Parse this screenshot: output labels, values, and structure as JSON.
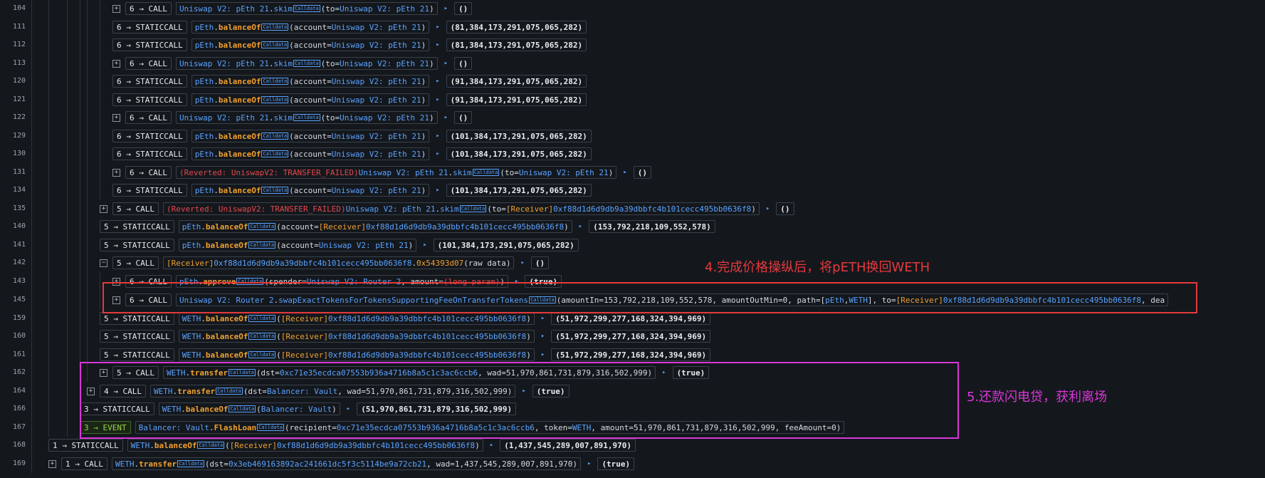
{
  "colors": {
    "address": "#5aa2ff",
    "tag": "#f0a030",
    "reverted": "#e5484d",
    "annotation_red": "#e5393b",
    "annotation_magenta": "#d936d9"
  },
  "icons": {
    "expand": "plus-square-icon",
    "collapse": "minus-square-icon",
    "return": "triangle-right-icon",
    "calldata": "calldata-icon"
  },
  "calldata_label": "Calldata",
  "annotations": {
    "step4": "4.完成价格操纵后，将pETH换回WETH",
    "step5": "5.还款闪电贷，获利离场"
  },
  "rows": [
    {
      "line": "104",
      "depth": "6",
      "type": "CALL",
      "toggle": "+",
      "segs": [
        [
          "Uniswap V2: pEth 21",
          "blue"
        ],
        [
          ".",
          ""
        ],
        [
          "skim",
          "blue"
        ],
        [
          "#cd",
          ""
        ],
        [
          "(to=",
          ""
        ],
        [
          "Uniswap V2: pEth 21",
          "blue"
        ],
        [
          ")",
          ""
        ]
      ],
      "ret": "()"
    },
    {
      "line": "111",
      "depth": "6",
      "type": "STATICCALL",
      "toggle": "",
      "segs": [
        [
          "pEth",
          "blue"
        ],
        [
          ".",
          ""
        ],
        [
          "balanceOf",
          "b"
        ],
        [
          "#cd",
          ""
        ],
        [
          "(account=",
          ""
        ],
        [
          "Uniswap V2: pEth 21",
          "blue"
        ],
        [
          ")",
          ""
        ]
      ],
      "ret": "(81,384,173,291,075,065,282)"
    },
    {
      "line": "112",
      "depth": "6",
      "type": "STATICCALL",
      "toggle": "",
      "segs": [
        [
          "pEth",
          "blue"
        ],
        [
          ".",
          ""
        ],
        [
          "balanceOf",
          "b"
        ],
        [
          "#cd",
          ""
        ],
        [
          "(account=",
          ""
        ],
        [
          "Uniswap V2: pEth 21",
          "blue"
        ],
        [
          ")",
          ""
        ]
      ],
      "ret": "(81,384,173,291,075,065,282)"
    },
    {
      "line": "113",
      "depth": "6",
      "type": "CALL",
      "toggle": "+",
      "segs": [
        [
          "Uniswap V2: pEth 21",
          "blue"
        ],
        [
          ".",
          ""
        ],
        [
          "skim",
          "blue"
        ],
        [
          "#cd",
          ""
        ],
        [
          "(to=",
          ""
        ],
        [
          "Uniswap V2: pEth 21",
          "blue"
        ],
        [
          ")",
          ""
        ]
      ],
      "ret": "()"
    },
    {
      "line": "120",
      "depth": "6",
      "type": "STATICCALL",
      "toggle": "",
      "segs": [
        [
          "pEth",
          "blue"
        ],
        [
          ".",
          ""
        ],
        [
          "balanceOf",
          "b"
        ],
        [
          "#cd",
          ""
        ],
        [
          "(account=",
          ""
        ],
        [
          "Uniswap V2: pEth 21",
          "blue"
        ],
        [
          ")",
          ""
        ]
      ],
      "ret": "(91,384,173,291,075,065,282)"
    },
    {
      "line": "121",
      "depth": "6",
      "type": "STATICCALL",
      "toggle": "",
      "segs": [
        [
          "pEth",
          "blue"
        ],
        [
          ".",
          ""
        ],
        [
          "balanceOf",
          "b"
        ],
        [
          "#cd",
          ""
        ],
        [
          "(account=",
          ""
        ],
        [
          "Uniswap V2: pEth 21",
          "blue"
        ],
        [
          ")",
          ""
        ]
      ],
      "ret": "(91,384,173,291,075,065,282)"
    },
    {
      "line": "122",
      "depth": "6",
      "type": "CALL",
      "toggle": "+",
      "segs": [
        [
          "Uniswap V2: pEth 21",
          "blue"
        ],
        [
          ".",
          ""
        ],
        [
          "skim",
          "blue"
        ],
        [
          "#cd",
          ""
        ],
        [
          "(to=",
          ""
        ],
        [
          "Uniswap V2: pEth 21",
          "blue"
        ],
        [
          ")",
          ""
        ]
      ],
      "ret": "()"
    },
    {
      "line": "129",
      "depth": "6",
      "type": "STATICCALL",
      "toggle": "",
      "segs": [
        [
          "pEth",
          "blue"
        ],
        [
          ".",
          ""
        ],
        [
          "balanceOf",
          "b"
        ],
        [
          "#cd",
          ""
        ],
        [
          "(account=",
          ""
        ],
        [
          "Uniswap V2: pEth 21",
          "blue"
        ],
        [
          ")",
          ""
        ]
      ],
      "ret": "(101,384,173,291,075,065,282)"
    },
    {
      "line": "130",
      "depth": "6",
      "type": "STATICCALL",
      "toggle": "",
      "segs": [
        [
          "pEth",
          "blue"
        ],
        [
          ".",
          ""
        ],
        [
          "balanceOf",
          "b"
        ],
        [
          "#cd",
          ""
        ],
        [
          "(account=",
          ""
        ],
        [
          "Uniswap V2: pEth 21",
          "blue"
        ],
        [
          ")",
          ""
        ]
      ],
      "ret": "(101,384,173,291,075,065,282)"
    },
    {
      "line": "131",
      "depth": "6",
      "type": "CALL",
      "toggle": "+",
      "segs": [
        [
          "(Reverted: UniswapV2: TRANSFER_FAILED)",
          "red"
        ],
        [
          " ",
          ""
        ],
        [
          "Uniswap V2: pEth 21",
          "blue"
        ],
        [
          ".",
          ""
        ],
        [
          "skim",
          "blue"
        ],
        [
          "#cd",
          ""
        ],
        [
          "(to=",
          ""
        ],
        [
          "Uniswap V2: pEth 21",
          "blue"
        ],
        [
          ")",
          ""
        ]
      ],
      "ret": "()"
    },
    {
      "line": "134",
      "depth": "6",
      "type": "STATICCALL",
      "toggle": "",
      "segs": [
        [
          "pEth",
          "blue"
        ],
        [
          ".",
          ""
        ],
        [
          "balanceOf",
          "b"
        ],
        [
          "#cd",
          ""
        ],
        [
          "(account=",
          ""
        ],
        [
          "Uniswap V2: pEth 21",
          "blue"
        ],
        [
          ")",
          ""
        ]
      ],
      "ret": "(101,384,173,291,075,065,282)"
    },
    {
      "line": "135",
      "depth": "5",
      "type": "CALL",
      "toggle": "+",
      "segs": [
        [
          "(Reverted: UniswapV2: TRANSFER_FAILED)",
          "red"
        ],
        [
          " ",
          ""
        ],
        [
          "Uniswap V2: pEth 21",
          "blue"
        ],
        [
          ".",
          ""
        ],
        [
          "skim",
          "blue"
        ],
        [
          "#cd",
          ""
        ],
        [
          "(to=",
          ""
        ],
        [
          "[Receiver]",
          "org"
        ],
        [
          "0xf88d1d6d9db9a39dbbfc4b101cecc495bb0636f8",
          "blue"
        ],
        [
          ")",
          ""
        ]
      ],
      "ret": "()"
    },
    {
      "line": "140",
      "depth": "5",
      "type": "STATICCALL",
      "toggle": "",
      "segs": [
        [
          "pEth",
          "blue"
        ],
        [
          ".",
          ""
        ],
        [
          "balanceOf",
          "b"
        ],
        [
          "#cd",
          ""
        ],
        [
          "(account=",
          ""
        ],
        [
          "[Receiver]",
          "org"
        ],
        [
          "0xf88d1d6d9db9a39dbbfc4b101cecc495bb0636f8",
          "blue"
        ],
        [
          ")",
          ""
        ]
      ],
      "ret": "(153,792,218,109,552,578)"
    },
    {
      "line": "141",
      "depth": "5",
      "type": "STATICCALL",
      "toggle": "",
      "segs": [
        [
          "pEth",
          "blue"
        ],
        [
          ".",
          ""
        ],
        [
          "balanceOf",
          "b"
        ],
        [
          "#cd",
          ""
        ],
        [
          "(account=",
          ""
        ],
        [
          "Uniswap V2: pEth 21",
          "blue"
        ],
        [
          ")",
          ""
        ]
      ],
      "ret": "(101,384,173,291,075,065,282)"
    },
    {
      "line": "142",
      "depth": "5",
      "type": "CALL",
      "toggle": "-",
      "segs": [
        [
          "[Receiver]",
          "org"
        ],
        [
          " ",
          ""
        ],
        [
          "0xf88d1d6d9db9a39dbbfc4b101cecc495bb0636f8",
          "blue"
        ],
        [
          ".",
          ""
        ],
        [
          "0x54393d07",
          "org"
        ],
        [
          "(raw data)",
          ""
        ]
      ],
      "ret": "()"
    },
    {
      "line": "143",
      "depth": "6",
      "type": "CALL",
      "toggle": "+",
      "segs": [
        [
          "pEth",
          "blue"
        ],
        [
          ".",
          ""
        ],
        [
          "approve",
          "b"
        ],
        [
          "#cd",
          ""
        ],
        [
          "(spender=",
          ""
        ],
        [
          "Uniswap V2: Router 2",
          "blue"
        ],
        [
          ", amount=",
          ""
        ],
        [
          "(long param)",
          "red"
        ],
        [
          ")",
          ""
        ]
      ],
      "ret": "(true)"
    },
    {
      "line": "145",
      "depth": "6",
      "type": "CALL",
      "toggle": "+",
      "segs": [
        [
          "Uniswap V2: Router 2",
          "blue"
        ],
        [
          ".",
          ""
        ],
        [
          "swapExactTokensForTokensSupportingFeeOnTransferTokens",
          "blue"
        ],
        [
          "#cd",
          ""
        ],
        [
          "(amountIn=153,792,218,109,552,578, amountOutMin=0, path=[",
          ""
        ],
        [
          "pEth",
          "blue"
        ],
        [
          ", ",
          ""
        ],
        [
          "WETH",
          "blue"
        ],
        [
          "], to=",
          ""
        ],
        [
          "[Receiver]",
          "org"
        ],
        [
          "0xf88d1d6d9db9a39dbbfc4b101cecc495bb0636f8",
          "blue"
        ],
        [
          ", dea",
          ""
        ]
      ],
      "ret": ""
    },
    {
      "line": "159",
      "depth": "5",
      "type": "STATICCALL",
      "toggle": "",
      "segs": [
        [
          "WETH",
          "blue"
        ],
        [
          ".",
          ""
        ],
        [
          "balanceOf",
          "b"
        ],
        [
          "#cd",
          ""
        ],
        [
          "(",
          ""
        ],
        [
          "[Receiver]",
          "org"
        ],
        [
          "0xf88d1d6d9db9a39dbbfc4b101cecc495bb0636f8",
          "blue"
        ],
        [
          ")",
          ""
        ]
      ],
      "ret": "(51,972,299,277,168,324,394,969)"
    },
    {
      "line": "160",
      "depth": "5",
      "type": "STATICCALL",
      "toggle": "",
      "segs": [
        [
          "WETH",
          "blue"
        ],
        [
          ".",
          ""
        ],
        [
          "balanceOf",
          "b"
        ],
        [
          "#cd",
          ""
        ],
        [
          "(",
          ""
        ],
        [
          "[Receiver]",
          "org"
        ],
        [
          "0xf88d1d6d9db9a39dbbfc4b101cecc495bb0636f8",
          "blue"
        ],
        [
          ")",
          ""
        ]
      ],
      "ret": "(51,972,299,277,168,324,394,969)"
    },
    {
      "line": "161",
      "depth": "5",
      "type": "STATICCALL",
      "toggle": "",
      "segs": [
        [
          "WETH",
          "blue"
        ],
        [
          ".",
          ""
        ],
        [
          "balanceOf",
          "b"
        ],
        [
          "#cd",
          ""
        ],
        [
          "(",
          ""
        ],
        [
          "[Receiver]",
          "org"
        ],
        [
          "0xf88d1d6d9db9a39dbbfc4b101cecc495bb0636f8",
          "blue"
        ],
        [
          ")",
          ""
        ]
      ],
      "ret": "(51,972,299,277,168,324,394,969)"
    },
    {
      "line": "162",
      "depth": "5",
      "type": "CALL",
      "toggle": "+",
      "segs": [
        [
          "WETH",
          "blue"
        ],
        [
          ".",
          ""
        ],
        [
          "transfer",
          "b"
        ],
        [
          "#cd",
          ""
        ],
        [
          "(dst=",
          ""
        ],
        [
          "0xc71e35ecdca07553b936a4716b8a5c1c3ac6ccb6",
          "blue"
        ],
        [
          ", wad=51,970,861,731,879,316,502,999)",
          ""
        ]
      ],
      "ret": "(true)"
    },
    {
      "line": "164",
      "depth": "4",
      "type": "CALL",
      "toggle": "+",
      "segs": [
        [
          "WETH",
          "blue"
        ],
        [
          ".",
          ""
        ],
        [
          "transfer",
          "b"
        ],
        [
          "#cd",
          ""
        ],
        [
          "(dst=",
          ""
        ],
        [
          "Balancer: Vault",
          "blue"
        ],
        [
          ", wad=51,970,861,731,879,316,502,999)",
          ""
        ]
      ],
      "ret": "(true)"
    },
    {
      "line": "166",
      "depth": "3",
      "type": "STATICCALL",
      "toggle": "",
      "segs": [
        [
          "WETH",
          "blue"
        ],
        [
          ".",
          ""
        ],
        [
          "balanceOf",
          "b"
        ],
        [
          "#cd",
          ""
        ],
        [
          "(",
          ""
        ],
        [
          "Balancer: Vault",
          "blue"
        ],
        [
          ")",
          ""
        ]
      ],
      "ret": "(51,970,861,731,879,316,502,999)"
    },
    {
      "line": "167",
      "depth": "3",
      "type": "EVENT",
      "toggle": "",
      "segs": [
        [
          "Balancer: Vault",
          "blue"
        ],
        [
          ".",
          ""
        ],
        [
          "FlashLoan",
          "b"
        ],
        [
          "#cd",
          ""
        ],
        [
          "(recipient=",
          ""
        ],
        [
          "0xc71e35ecdca07553b936a4716b8a5c1c3ac6ccb6",
          "blue"
        ],
        [
          ", token=",
          ""
        ],
        [
          "WETH",
          "blue"
        ],
        [
          ", amount=51,970,861,731,879,316,502,999, feeAmount=0)",
          ""
        ]
      ],
      "ret": ""
    },
    {
      "line": "168",
      "depth": "1",
      "type": "STATICCALL",
      "toggle": "",
      "segs": [
        [
          "WETH",
          "blue"
        ],
        [
          ".",
          ""
        ],
        [
          "balanceOf",
          "b"
        ],
        [
          "#cd",
          ""
        ],
        [
          "(",
          ""
        ],
        [
          "[Receiver]",
          "org"
        ],
        [
          "0xf88d1d6d9db9a39dbbfc4b101cecc495bb0636f8",
          "blue"
        ],
        [
          ")",
          ""
        ]
      ],
      "ret": "(1,437,545,289,007,891,970)"
    },
    {
      "line": "169",
      "depth": "1",
      "type": "CALL",
      "toggle": "+",
      "segs": [
        [
          "WETH",
          "blue"
        ],
        [
          ".",
          ""
        ],
        [
          "transfer",
          "b"
        ],
        [
          "#cd",
          ""
        ],
        [
          "(dst=",
          ""
        ],
        [
          "0x3eb469163892ac241661dc5f3c5114be9a72cb21",
          "blue"
        ],
        [
          ", wad=1,437,545,289,007,891,970)",
          ""
        ]
      ],
      "ret": "(true)"
    }
  ]
}
